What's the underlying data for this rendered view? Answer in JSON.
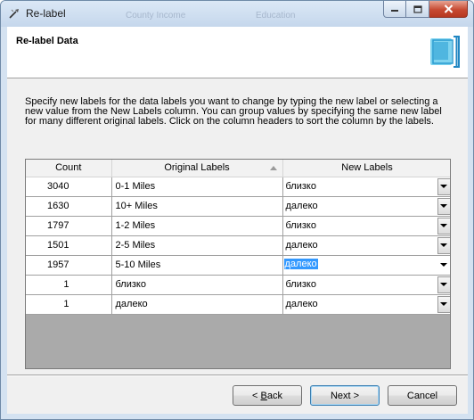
{
  "window": {
    "title": "Re-label",
    "ghost_tabs": [
      "County Income",
      "Education"
    ]
  },
  "header": {
    "title": "Re-label Data",
    "logo_icon": "relabel-wizard-icon"
  },
  "description": "Specify new labels for the data labels you want to change by typing the new label or selecting a new value from the New Labels column. You can group values by specifying the same new label for many different original labels.  Click on the column headers to sort the column by the labels.",
  "grid": {
    "columns": [
      "Count",
      "Original Labels",
      "New Labels"
    ],
    "sorted_column": "Original Labels",
    "rows": [
      {
        "count": "3040",
        "original": "0-1 Miles",
        "new": "близко"
      },
      {
        "count": "1630",
        "original": "10+ Miles",
        "new": "далеко"
      },
      {
        "count": "1797",
        "original": "1-2 Miles",
        "new": "близко"
      },
      {
        "count": "1501",
        "original": "2-5 Miles",
        "new": "далеко"
      },
      {
        "count": "1957",
        "original": "5-10 Miles",
        "new": "далеко"
      },
      {
        "count": "1",
        "original": "близко",
        "new": "близко"
      },
      {
        "count": "1",
        "original": "далеко",
        "new": "далеко"
      }
    ],
    "active_row": 4
  },
  "buttons": {
    "back_prefix": "< ",
    "back_access": "B",
    "back_rest": "ack",
    "next": "Next >",
    "cancel": "Cancel"
  },
  "colors": {
    "selection": "#3399ff",
    "close_button": "#c74a32",
    "window_frame": "#d4e2f1"
  }
}
